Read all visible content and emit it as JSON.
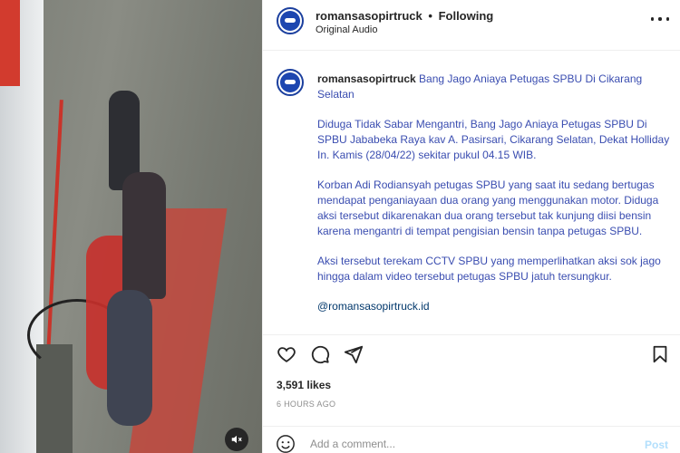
{
  "header": {
    "username": "romansasopirtruck",
    "separator": "•",
    "follow_status": "Following",
    "audio": "Original Audio"
  },
  "caption": {
    "username": "romansasopirtruck",
    "title": "Bang Jago Aniaya Petugas SPBU Di Cikarang Selatan",
    "paragraphs": [
      "Diduga Tidak Sabar Mengantri, Bang Jago Aniaya Petugas SPBU Di SPBU Jababeka Raya kav A. Pasirsari, Cikarang Selatan, Dekat Holliday In. Kamis (28/04/22) sekitar pukul 04.15 WIB.",
      "Korban Adi Rodiansyah petugas SPBU yang saat itu sedang bertugas mendapat penganiayaan dua orang yang menggunakan motor. Diduga aksi tersebut dikarenakan dua orang tersebut tak kunjung diisi bensin karena mengantri di tempat pengisian bensin tanpa petugas SPBU.",
      "Aksi tersebut terekam CCTV SPBU yang memperlihatkan aksi sok jago hingga dalam video tersebut petugas SPBU jatuh tersungkur."
    ],
    "mention": "@romansasopirtruck.id"
  },
  "stats": {
    "likes": "3,591 likes",
    "time_ago": "6 HOURS AGO"
  },
  "comment": {
    "placeholder": "Add a comment...",
    "post_label": "Post"
  },
  "icons": {
    "like": "heart-icon",
    "comment": "comment-icon",
    "share": "share-icon",
    "save": "bookmark-icon",
    "more": "more-dots-icon",
    "mute": "speaker-muted-icon",
    "emoji": "emoji-icon"
  },
  "colors": {
    "caption_text": "#3a4db0",
    "mention": "#00376b",
    "post_disabled": "#b2dffc",
    "avatar_brand": "#1d46b0"
  }
}
